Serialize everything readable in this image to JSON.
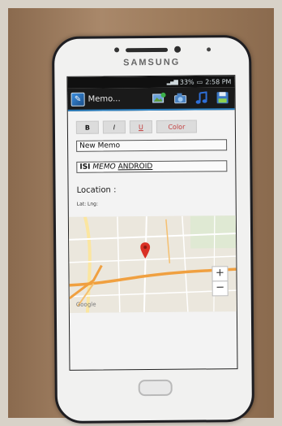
{
  "device": {
    "brand": "SAMSUNG"
  },
  "status_bar": {
    "battery": "33%",
    "time": "2:58 PM"
  },
  "action_bar": {
    "title": "Memo...",
    "actions": [
      "add-image-icon",
      "camera-icon",
      "music-note-icon",
      "save-floppy-icon"
    ]
  },
  "toolbar": {
    "bold": "B",
    "italic": "I",
    "underline": "U",
    "color": "Color"
  },
  "memo": {
    "title_value": "New Memo",
    "body_part1": "ISI",
    "body_part2": "MEMO",
    "body_part3": "ANDROID"
  },
  "location": {
    "heading": "Location :",
    "latlng": "Lat: Lng:"
  },
  "map": {
    "zoom_in": "+",
    "zoom_out": "−",
    "attribution": "Google"
  },
  "colors": {
    "accent": "#2a7fc0",
    "marker": "#d93025",
    "route": "#f0a040"
  }
}
